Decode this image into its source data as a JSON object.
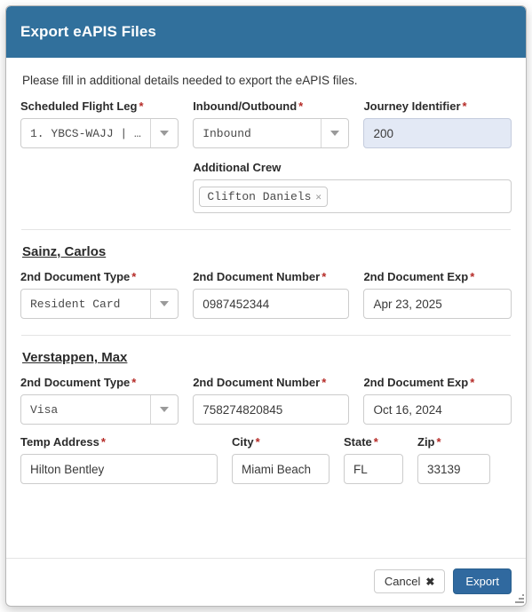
{
  "dialog": {
    "title": "Export eAPIS Files",
    "intro": "Please fill in additional details needed to export the eAPIS files."
  },
  "flight_section": {
    "scheduled_flight_leg": {
      "label": "Scheduled Flight Leg",
      "required": "*",
      "value": "1. YBCS-WAJJ | …"
    },
    "inbound_outbound": {
      "label": "Inbound/Outbound",
      "required": "*",
      "value": "Inbound"
    },
    "journey_identifier": {
      "label": "Journey Identifier",
      "required": "*",
      "value": "200"
    },
    "additional_crew": {
      "label": "Additional Crew",
      "tags": [
        {
          "name": "Clifton Daniels",
          "remove_icon": "✕"
        }
      ]
    }
  },
  "people": [
    {
      "name": "Sainz, Carlos",
      "doc_type": {
        "label": "2nd Document Type",
        "required": "*",
        "value": "Resident Card"
      },
      "doc_number": {
        "label": "2nd Document Number",
        "required": "*",
        "value": "0987452344"
      },
      "doc_exp": {
        "label": "2nd Document Exp",
        "required": "*",
        "value": "Apr 23, 2025"
      }
    },
    {
      "name": "Verstappen, Max",
      "doc_type": {
        "label": "2nd Document Type",
        "required": "*",
        "value": "Visa"
      },
      "doc_number": {
        "label": "2nd Document Number",
        "required": "*",
        "value": "758274820845"
      },
      "doc_exp": {
        "label": "2nd Document Exp",
        "required": "*",
        "value": "Oct 16, 2024"
      },
      "temp_address": {
        "label": "Temp Address",
        "required": "*",
        "value": "Hilton Bentley"
      },
      "city": {
        "label": "City",
        "required": "*",
        "value": "Miami Beach"
      },
      "state": {
        "label": "State",
        "required": "*",
        "value": "FL"
      },
      "zip": {
        "label": "Zip",
        "required": "*",
        "value": "33139"
      }
    }
  ],
  "footer": {
    "cancel_label": "Cancel",
    "cancel_icon": "✖",
    "export_label": "Export"
  },
  "colors": {
    "header_blue": "#31709c",
    "primary_button": "#30699f",
    "required_red": "#b52b27",
    "highlight_field": "#e3e9f5"
  }
}
